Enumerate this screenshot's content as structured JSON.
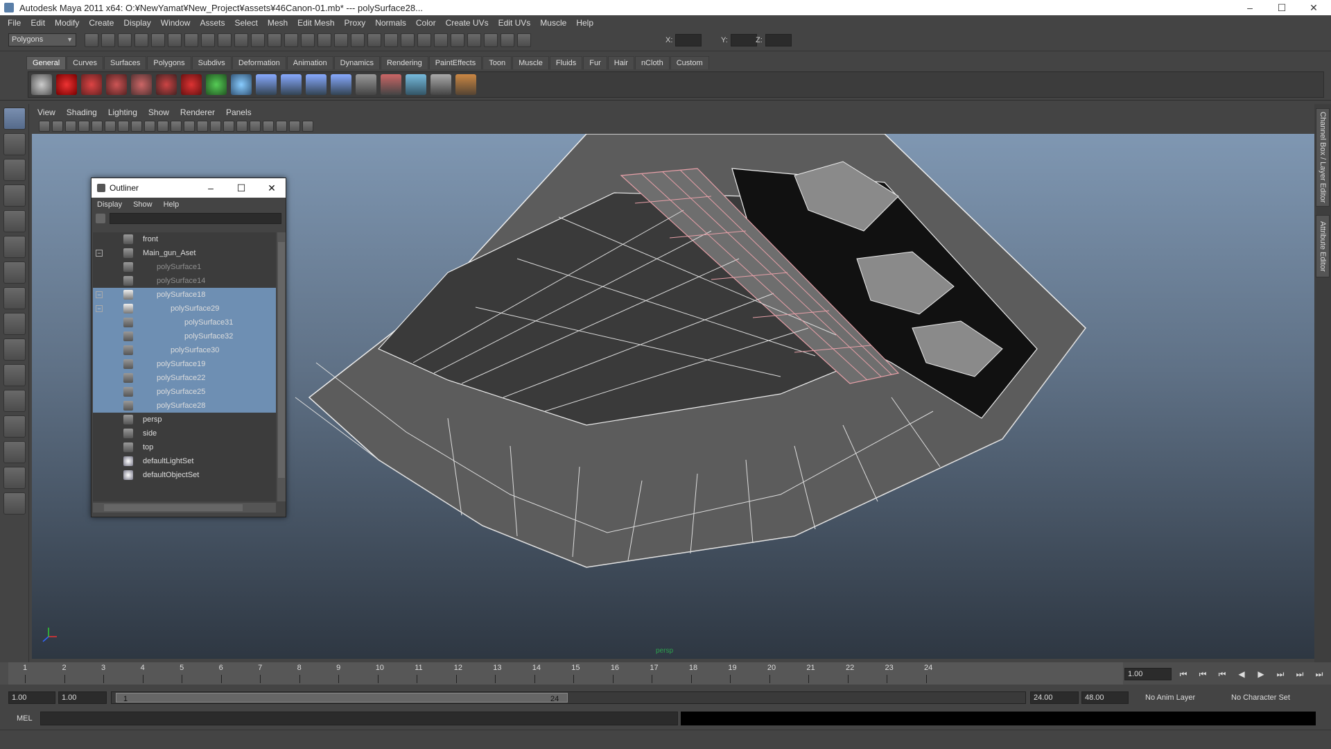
{
  "window": {
    "title": "Autodesk Maya 2011 x64: O:¥NewYamat¥New_Project¥assets¥46Canon-01.mb*   ---   polySurface28...",
    "minimize_glyph": "–",
    "maximize_glyph": "☐",
    "close_glyph": "✕"
  },
  "menus": [
    "File",
    "Edit",
    "Modify",
    "Create",
    "Display",
    "Window",
    "Assets",
    "Select",
    "Mesh",
    "Edit Mesh",
    "Proxy",
    "Normals",
    "Color",
    "Create UVs",
    "Edit UVs",
    "Muscle",
    "Help"
  ],
  "status_line": {
    "mode": "Polygons",
    "x_label": "X:",
    "y_label": "Y:",
    "z_label": "Z:"
  },
  "shelf": {
    "tabs": [
      "General",
      "Curves",
      "Surfaces",
      "Polygons",
      "Subdivs",
      "Deformation",
      "Animation",
      "Dynamics",
      "Rendering",
      "PaintEffects",
      "Toon",
      "Muscle",
      "Fluids",
      "Fur",
      "Hair",
      "nCloth",
      "Custom"
    ],
    "active_tab": "General"
  },
  "panel_menus": [
    "View",
    "Shading",
    "Lighting",
    "Show",
    "Renderer",
    "Panels"
  ],
  "viewport": {
    "camera": "persp",
    "background_top": "#7f97b2",
    "background_bottom": "#2e3742",
    "selection_wire_color": "#e8a0a8"
  },
  "side_tabs": {
    "channel_box": "Channel Box / Layer Editor",
    "attribute_editor": "Attribute Editor"
  },
  "outliner": {
    "title": "Outliner",
    "menus": [
      "Display",
      "Show",
      "Help"
    ],
    "items": [
      {
        "label": "front",
        "expander": "",
        "selected": false,
        "dim": false,
        "icon": "camera-icon"
      },
      {
        "label": "Main_gun_Aset",
        "expander": "−",
        "selected": false,
        "dim": false,
        "icon": "group-icon"
      },
      {
        "label": "polySurface1",
        "expander": "",
        "selected": false,
        "dim": true,
        "icon": "mesh-icon"
      },
      {
        "label": "polySurface14",
        "expander": "",
        "selected": false,
        "dim": true,
        "icon": "mesh-icon"
      },
      {
        "label": "polySurface18",
        "expander": "−",
        "selected": true,
        "dim": false,
        "icon": "transform-icon"
      },
      {
        "label": "polySurface29",
        "expander": "−",
        "selected": true,
        "dim": false,
        "icon": "transform-icon"
      },
      {
        "label": "polySurface31",
        "expander": "",
        "selected": true,
        "dim": false,
        "icon": "mesh-icon"
      },
      {
        "label": "polySurface32",
        "expander": "",
        "selected": true,
        "dim": false,
        "icon": "mesh-icon"
      },
      {
        "label": "polySurface30",
        "expander": "",
        "selected": true,
        "dim": false,
        "icon": "mesh-icon"
      },
      {
        "label": "polySurface19",
        "expander": "",
        "selected": true,
        "dim": false,
        "icon": "mesh-icon"
      },
      {
        "label": "polySurface22",
        "expander": "",
        "selected": true,
        "dim": false,
        "icon": "mesh-icon"
      },
      {
        "label": "polySurface25",
        "expander": "",
        "selected": true,
        "dim": false,
        "icon": "mesh-icon"
      },
      {
        "label": "polySurface28",
        "expander": "",
        "selected": true,
        "dim": false,
        "icon": "mesh-icon"
      },
      {
        "label": "persp",
        "expander": "",
        "selected": false,
        "dim": false,
        "icon": "camera-icon"
      },
      {
        "label": "side",
        "expander": "",
        "selected": false,
        "dim": false,
        "icon": "camera-icon"
      },
      {
        "label": "top",
        "expander": "",
        "selected": false,
        "dim": false,
        "icon": "camera-icon"
      },
      {
        "label": "defaultLightSet",
        "expander": "",
        "selected": false,
        "dim": false,
        "icon": "set-icon"
      },
      {
        "label": "defaultObjectSet",
        "expander": "",
        "selected": false,
        "dim": false,
        "icon": "set-icon"
      }
    ]
  },
  "time_slider": {
    "ticks": [
      "1",
      "2",
      "3",
      "4",
      "5",
      "6",
      "7",
      "8",
      "9",
      "10",
      "11",
      "12",
      "13",
      "14",
      "15",
      "16",
      "17",
      "18",
      "19",
      "20",
      "21",
      "22",
      "23",
      "24"
    ],
    "current_frame": "1.00",
    "play_glyphs": [
      "⏮",
      "⏮",
      "⏮",
      "◀",
      "▶",
      "⏭",
      "⏭",
      "⏭"
    ]
  },
  "range_slider": {
    "start_time": "1.00",
    "playback_start": "1.00",
    "range_start": "1",
    "range_end": "24",
    "playback_end": "24.00",
    "end_time": "48.00",
    "anim_layer": "No Anim Layer",
    "character_set": "No Character Set"
  },
  "command_line": {
    "language": "MEL"
  }
}
